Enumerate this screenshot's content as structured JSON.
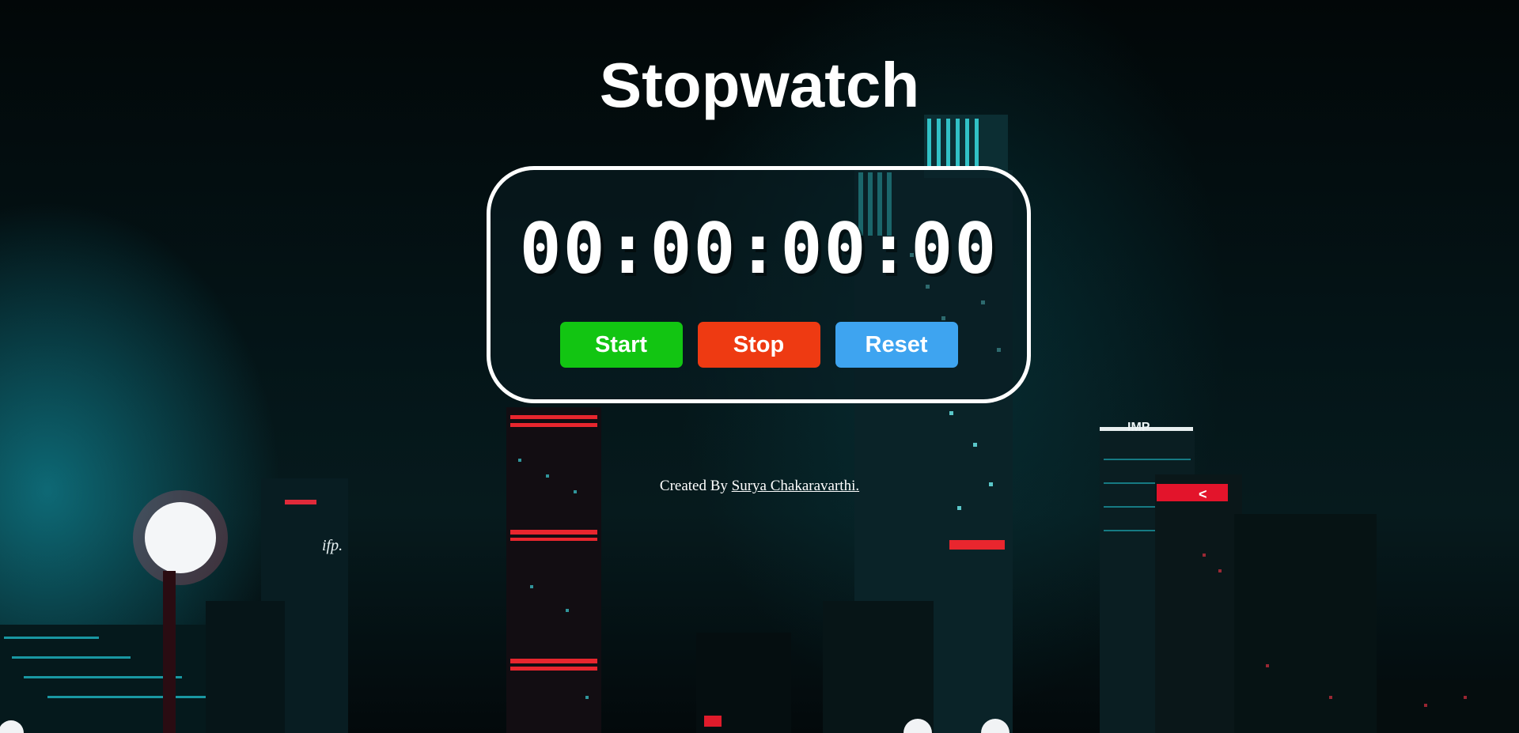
{
  "app": {
    "title": "Stopwatch"
  },
  "stopwatch": {
    "time": "00:00:00:00",
    "buttons": [
      {
        "id": "start",
        "label": "Start",
        "color": "#12c512"
      },
      {
        "id": "stop",
        "label": "Stop",
        "color": "#ee3a12"
      },
      {
        "id": "reset",
        "label": "Reset",
        "color": "#3ea4f0"
      }
    ]
  },
  "footer": {
    "prefix": "Created By",
    "author": "Surya Chakaravarthi."
  },
  "background": {
    "description_icon": "night-city-skyline-image",
    "sign_texts": [
      "ifp.",
      "IMP"
    ]
  }
}
